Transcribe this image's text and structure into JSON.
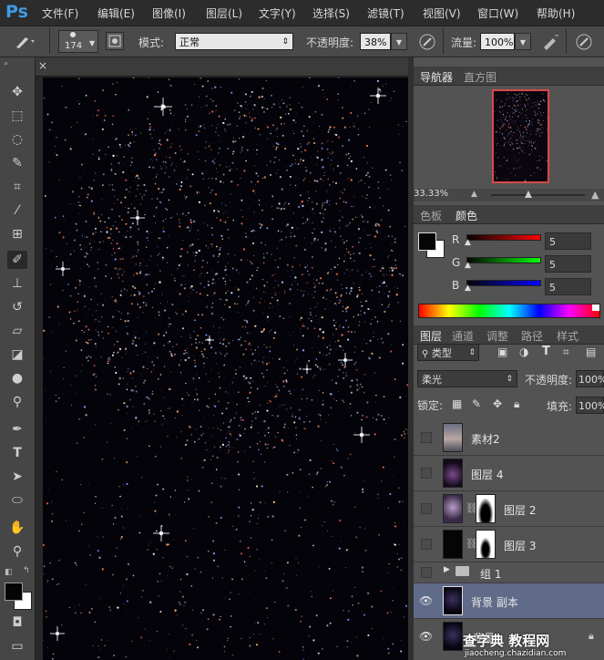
{
  "app": {
    "logo": "Ps"
  },
  "menu": [
    "文件(F)",
    "编辑(E)",
    "图像(I)",
    "图层(L)",
    "文字(Y)",
    "选择(S)",
    "滤镜(T)",
    "视图(V)",
    "窗口(W)",
    "帮助(H)"
  ],
  "options": {
    "brush_size": "174",
    "mode_label": "模式:",
    "mode_value": "正常",
    "opacity_label": "不透明度:",
    "opacity_value": "38%",
    "flow_label": "流量:",
    "flow_value": "100%"
  },
  "navigator": {
    "tabs": [
      "导航器",
      "直方图"
    ],
    "zoom": "33.33%"
  },
  "color": {
    "tabs": [
      "色板",
      "颜色"
    ],
    "r_label": "R",
    "r_value": "5",
    "g_label": "G",
    "g_value": "5",
    "b_label": "B",
    "b_value": "5",
    "foreground": "#050505",
    "background": "#ffffff"
  },
  "layers": {
    "tabs": [
      "图层",
      "通道",
      "调整",
      "路径",
      "样式"
    ],
    "filter_value": "类型",
    "blend_value": "柔光",
    "opacity_label": "不透明度:",
    "opacity_value": "100%",
    "lock_label": "锁定:",
    "fill_label": "填充:",
    "fill_value": "100%",
    "items": [
      {
        "name": "素材2",
        "visible": false
      },
      {
        "name": "图层 4",
        "visible": false
      },
      {
        "name": "图层 2",
        "visible": false
      },
      {
        "name": "图层 3",
        "visible": false
      },
      {
        "name": "组 1",
        "visible": false
      },
      {
        "name": "背景 副本",
        "visible": true
      },
      {
        "name": "背景",
        "visible": true
      }
    ]
  },
  "watermark": {
    "title": "查字典 教程网",
    "url": "jiaocheng.chazidian.com"
  }
}
